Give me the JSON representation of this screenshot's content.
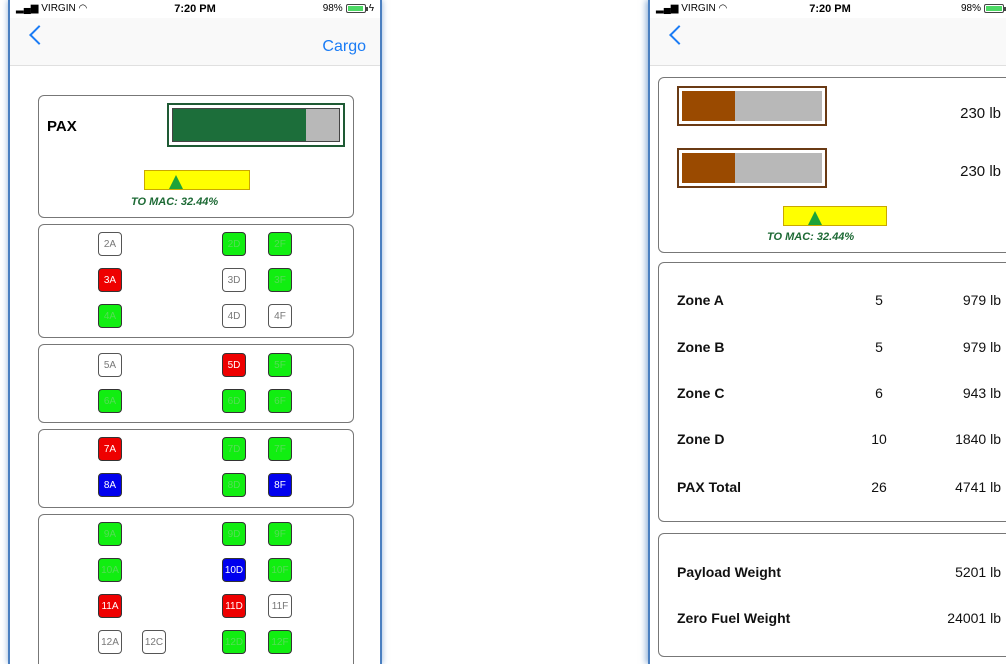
{
  "status": {
    "carrier": "VIRGIN",
    "time": "7:20 PM",
    "battery": "98%"
  },
  "left": {
    "nav_right": "Cargo",
    "pax_label": "PAX",
    "pax_fill_fraction": 0.8,
    "mac_label": "TO MAC: 32.44%",
    "mac_pointer_fraction": 0.3,
    "seats": [
      {
        "id": "2A",
        "state": "empty"
      },
      {
        "id": "2D",
        "state": "green"
      },
      {
        "id": "2F",
        "state": "green"
      },
      {
        "id": "3A",
        "state": "red"
      },
      {
        "id": "3D",
        "state": "empty"
      },
      {
        "id": "3F",
        "state": "green"
      },
      {
        "id": "4A",
        "state": "green"
      },
      {
        "id": "4D",
        "state": "empty"
      },
      {
        "id": "4F",
        "state": "empty"
      },
      {
        "id": "5A",
        "state": "empty"
      },
      {
        "id": "5D",
        "state": "red"
      },
      {
        "id": "5F",
        "state": "green"
      },
      {
        "id": "6A",
        "state": "green"
      },
      {
        "id": "6D",
        "state": "green"
      },
      {
        "id": "6F",
        "state": "green"
      },
      {
        "id": "7A",
        "state": "red"
      },
      {
        "id": "7D",
        "state": "green"
      },
      {
        "id": "7F",
        "state": "green"
      },
      {
        "id": "8A",
        "state": "blue"
      },
      {
        "id": "8D",
        "state": "green"
      },
      {
        "id": "8F",
        "state": "blue"
      },
      {
        "id": "9A",
        "state": "green"
      },
      {
        "id": "9D",
        "state": "green"
      },
      {
        "id": "9F",
        "state": "green"
      },
      {
        "id": "10A",
        "state": "green"
      },
      {
        "id": "10D",
        "state": "blue"
      },
      {
        "id": "10F",
        "state": "green"
      },
      {
        "id": "11A",
        "state": "red"
      },
      {
        "id": "11D",
        "state": "red"
      },
      {
        "id": "11F",
        "state": "empty"
      },
      {
        "id": "12A",
        "state": "empty"
      },
      {
        "id": "12C",
        "state": "empty"
      },
      {
        "id": "12D",
        "state": "green"
      },
      {
        "id": "12F",
        "state": "green"
      }
    ]
  },
  "right": {
    "cargo_bars": [
      {
        "weight": "230 lb",
        "fill_fraction": 0.38
      },
      {
        "weight": "230 lb",
        "fill_fraction": 0.38
      }
    ],
    "mac_label": "TO MAC: 32.44%",
    "mac_pointer_fraction": 0.3,
    "zones": [
      {
        "label": "Zone A",
        "count": "5",
        "weight": "979 lb"
      },
      {
        "label": "Zone B",
        "count": "5",
        "weight": "979 lb"
      },
      {
        "label": "Zone C",
        "count": "6",
        "weight": "943 lb"
      },
      {
        "label": "Zone D",
        "count": "10",
        "weight": "1840 lb"
      },
      {
        "label": "PAX Total",
        "count": "26",
        "weight": "4741 lb"
      }
    ],
    "totals": [
      {
        "label": "Payload Weight",
        "weight": "5201 lb"
      },
      {
        "label": "Zero Fuel Weight",
        "weight": "24001 lb"
      }
    ]
  },
  "colors": {
    "green": "#11ee11",
    "red": "#ee0000",
    "blue": "#0000ee",
    "pax_fill": "#1c6e3a",
    "cargo_fill": "#9a4a00",
    "mac_yellow": "#ffff00",
    "ios_blue": "#1a7cf5"
  }
}
